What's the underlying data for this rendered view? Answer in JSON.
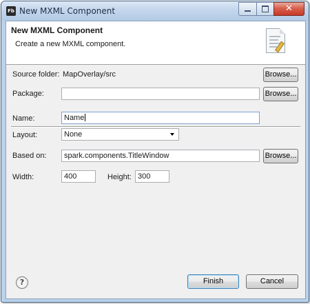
{
  "window": {
    "title": "New MXML Component",
    "icon_label": "Fb",
    "close_glyph": "✕"
  },
  "banner": {
    "title": "New MXML Component",
    "description": "Create a new MXML component."
  },
  "form": {
    "source_folder_label": "Source folder:",
    "source_folder_value": "MapOverlay/src",
    "package_label": "Package:",
    "package_value": "",
    "name_label": "Name:",
    "name_value": "Name",
    "layout_label": "Layout:",
    "layout_value": "None",
    "based_on_label": "Based on:",
    "based_on_value": "spark.components.TitleWindow",
    "width_label": "Width:",
    "width_value": "400",
    "height_label": "Height:",
    "height_value": "300"
  },
  "buttons": {
    "browse": "Browse...",
    "finish": "Finish",
    "cancel": "Cancel",
    "help_glyph": "?"
  }
}
